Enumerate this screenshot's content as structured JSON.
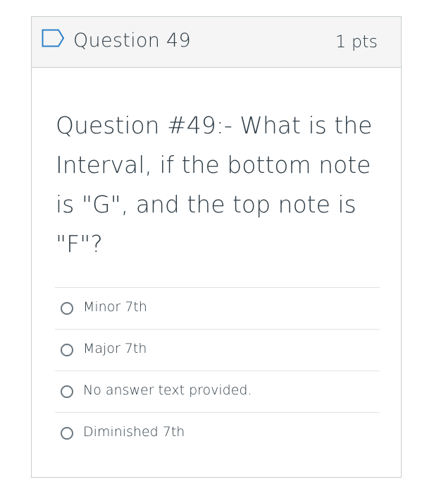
{
  "question": {
    "title": "Question 49",
    "points": "1 pts",
    "text": "Question #49:- What is the Interval, if the bottom note is \"G\", and the top note is \"F\"?",
    "flag_icon": "flag-outline-icon",
    "answers": [
      {
        "label": "Minor 7th",
        "selected": false
      },
      {
        "label": "Major 7th",
        "selected": false
      },
      {
        "label": "No answer text provided.",
        "selected": false
      },
      {
        "label": "Diminished 7th",
        "selected": false
      }
    ]
  },
  "colors": {
    "text": "#2d3b45",
    "flag": "#2d7fc7",
    "header_bg": "#f5f5f5",
    "border": "#c7cdd1"
  }
}
